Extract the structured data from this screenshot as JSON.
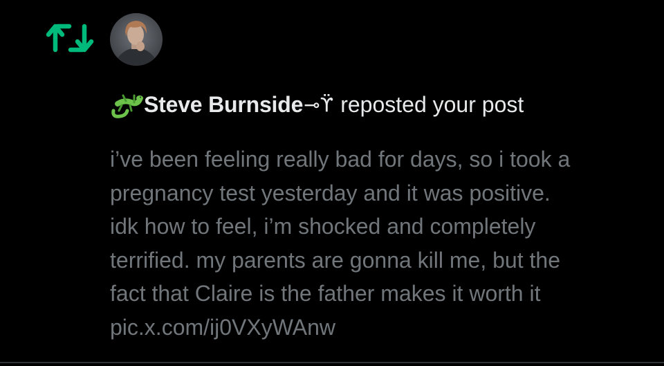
{
  "notification": {
    "type": "repost",
    "user": {
      "display_name": "Steve Burnside",
      "name_prefix_emoji": "lizard",
      "name_suffix_glyph": "⊸ϔ"
    },
    "action_text": "reposted your post",
    "post": {
      "lines": [
        "i’ve been feeling really bad for days, so i took a",
        "pregnancy test yesterday and it was positive.",
        "idk how to feel, i’m shocked and completely",
        "terrified. my parents are gonna kill me, but the",
        "fact that Claire is the father makes it worth it"
      ],
      "link": "pic.x.com/ij0VXyWAnw"
    }
  },
  "icons": {
    "repost": "repost-icon",
    "emoji": "lizard-emoji"
  },
  "colors": {
    "background": "#000000",
    "repost_green": "#00ba7c",
    "primary_text": "#e7e9ea",
    "secondary_text": "#71767b",
    "divider": "#2f3336",
    "lizard_green": "#6cc24a"
  }
}
